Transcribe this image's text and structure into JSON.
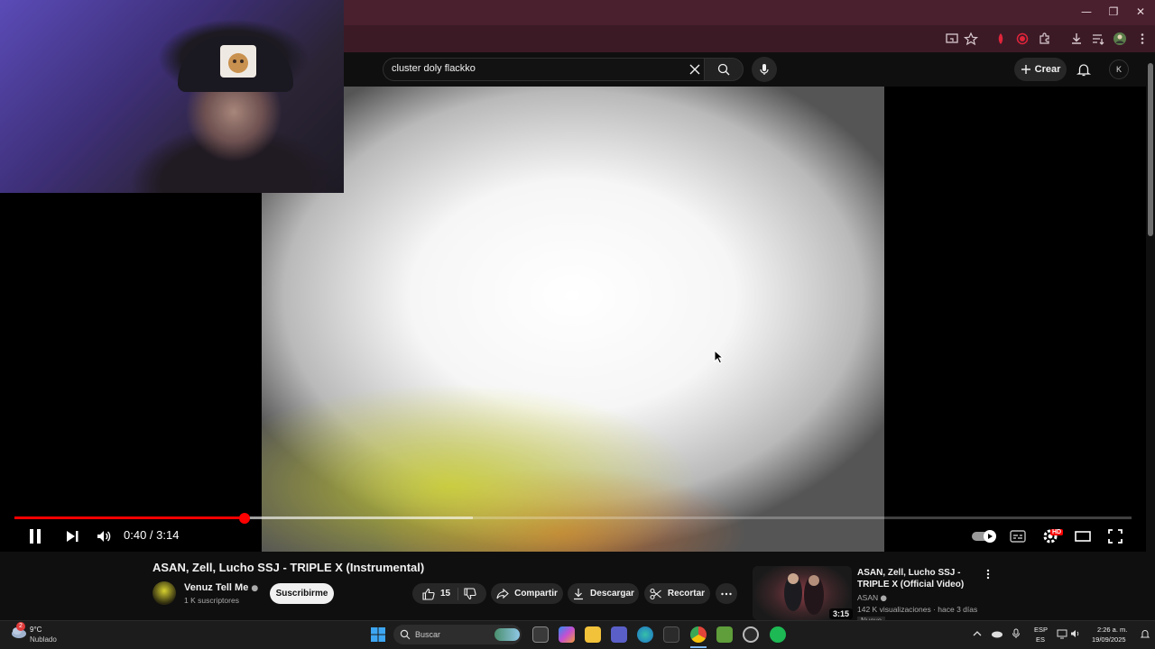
{
  "browser": {
    "window_controls": {
      "minimize": "—",
      "maximize": "❐",
      "close": "✕"
    },
    "toolbar_icons": [
      "cast-icon",
      "bookmark-star-icon",
      "extension-red-icon",
      "record-icon",
      "extensions-puzzle-icon",
      "download-icon",
      "reading-list-icon",
      "profile-icon",
      "menu-kebab-icon"
    ]
  },
  "youtube": {
    "search": {
      "value": "cluster doly flackko",
      "placeholder": "Buscar"
    },
    "create_label": "Crear",
    "avatar_initial": "K"
  },
  "player": {
    "current_time": "0:40",
    "duration": "3:14",
    "time_display": "0:40 / 3:14",
    "progress_fraction": 0.2062,
    "buffered_fraction": 0.41,
    "quality_badge": "HD",
    "autoplay": true
  },
  "video": {
    "title": "ASAN, Zell, Lucho SSJ - TRIPLE X (Instrumental)",
    "channel": "Venuz Tell Me",
    "subscribers": "1 K suscriptores",
    "subscribe_label": "Suscribirme",
    "likes": "15",
    "share_label": "Compartir",
    "download_label": "Descargar",
    "clip_label": "Recortar"
  },
  "recommendation": {
    "title": "ASAN, Zell, Lucho SSJ - TRIPLE X (Official Video)",
    "channel": "ASAN",
    "meta": "142 K visualizaciones · hace 3 días",
    "badge": "Nuevo",
    "duration": "3:15"
  },
  "taskbar": {
    "weather_temp": "9°C",
    "weather_desc": "Nublado",
    "weather_alerts": "2",
    "search_label": "Buscar",
    "lang_line1": "ESP",
    "lang_line2": "ES",
    "clock_time": "2:26 a. m.",
    "clock_date": "19/09/2025"
  },
  "colors": {
    "accent": "#ff0000",
    "browser_frame": "#4a1f2e",
    "background": "#0f0f0f"
  }
}
